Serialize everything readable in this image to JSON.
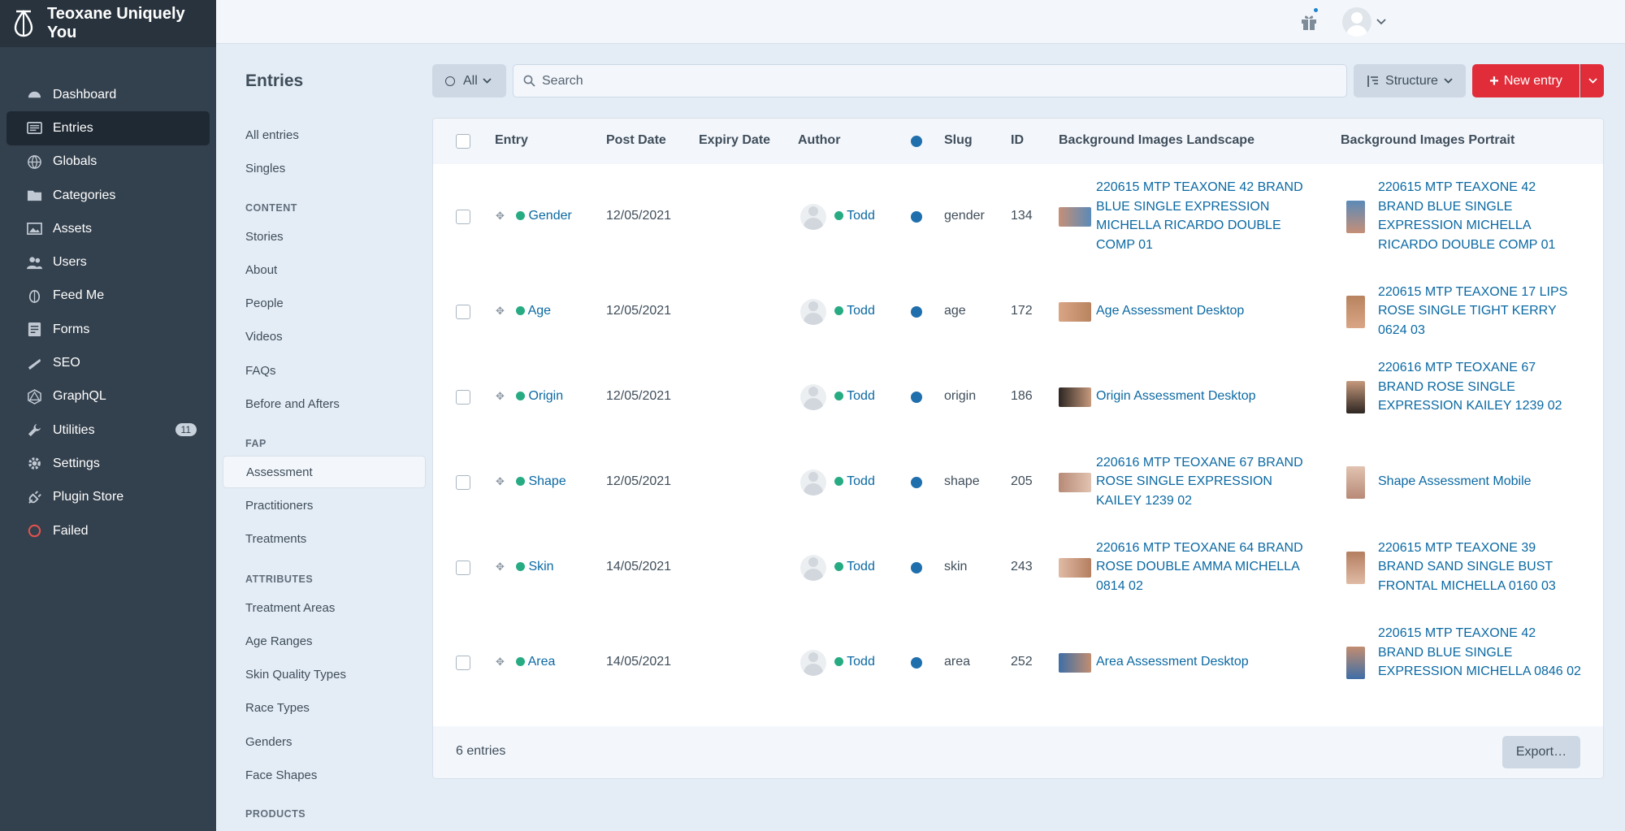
{
  "app": {
    "site_name": "Teoxane Uniquely You",
    "colors": {
      "sidebar_bg": "#33404d",
      "accent_red": "#e12d39",
      "link_blue": "#0b69a3",
      "status_green": "#27ab83"
    }
  },
  "global_nav": [
    {
      "label": "Dashboard",
      "icon": "dashboard-icon"
    },
    {
      "label": "Entries",
      "icon": "entries-icon",
      "active": true
    },
    {
      "label": "Globals",
      "icon": "globe-icon"
    },
    {
      "label": "Categories",
      "icon": "folder-icon"
    },
    {
      "label": "Assets",
      "icon": "image-icon"
    },
    {
      "label": "Users",
      "icon": "users-icon"
    },
    {
      "label": "Feed Me",
      "icon": "feed-me-icon"
    },
    {
      "label": "Forms",
      "icon": "forms-icon"
    },
    {
      "label": "SEO",
      "icon": "seo-icon"
    },
    {
      "label": "GraphQL",
      "icon": "graphql-icon"
    },
    {
      "label": "Utilities",
      "icon": "wrench-icon",
      "badge": "11"
    },
    {
      "label": "Settings",
      "icon": "gear-icon"
    },
    {
      "label": "Plugin Store",
      "icon": "plug-icon"
    },
    {
      "label": "Failed",
      "icon": "failed-circle-icon"
    }
  ],
  "page": {
    "title": "Entries"
  },
  "sources": {
    "top": [
      "All entries",
      "Singles"
    ],
    "content_heading": "CONTENT",
    "content": [
      "Stories",
      "About",
      "People",
      "Videos",
      "FAQs",
      "Before and Afters"
    ],
    "fap_heading": "FAP",
    "fap": [
      "Assessment",
      "Practitioners",
      "Treatments"
    ],
    "attributes_heading": "ATTRIBUTES",
    "attributes": [
      "Treatment Areas",
      "Age Ranges",
      "Skin Quality Types",
      "Race Types",
      "Genders",
      "Face Shapes"
    ],
    "products_heading": "PRODUCTS",
    "selected": "Assessment"
  },
  "toolbar": {
    "status_label": "All",
    "search_placeholder": "Search",
    "structure_label": "Structure",
    "new_entry_label": "New entry"
  },
  "table": {
    "columns": [
      "Entry",
      "Post Date",
      "Expiry Date",
      "Author",
      "Slug",
      "ID",
      "Background Images Landscape",
      "Background Images Portrait"
    ],
    "rows": [
      {
        "entry": "Gender",
        "post_date": "12/05/2021",
        "expiry": "",
        "author": "Todd",
        "slug": "gender",
        "id": "134",
        "landscape": "220615 MTP TEAXONE 42 BRAND BLUE SINGLE EXPRESSION MICHELLA RICARDO DOUBLE COMP 01",
        "portrait": "220615 MTP TEAXONE 42 BRAND BLUE SINGLE EXPRESSION MICHELLA RICARDO DOUBLE COMP 01"
      },
      {
        "entry": "Age",
        "post_date": "12/05/2021",
        "expiry": "",
        "author": "Todd",
        "slug": "age",
        "id": "172",
        "landscape": "Age Assessment Desktop",
        "portrait": "220615 MTP TEAXONE 17 LIPS ROSE SINGLE TIGHT KERRY 0624 03"
      },
      {
        "entry": "Origin",
        "post_date": "12/05/2021",
        "expiry": "",
        "author": "Todd",
        "slug": "origin",
        "id": "186",
        "landscape": "Origin Assessment Desktop",
        "portrait": "220616 MTP TEOXANE 67 BRAND ROSE SINGLE EXPRESSION KAILEY 1239 02"
      },
      {
        "entry": "Shape",
        "post_date": "12/05/2021",
        "expiry": "",
        "author": "Todd",
        "slug": "shape",
        "id": "205",
        "landscape": "220616 MTP TEOXANE 67 BRAND ROSE SINGLE EXPRESSION KAILEY 1239 02",
        "portrait": "Shape Assessment Mobile"
      },
      {
        "entry": "Skin",
        "post_date": "14/05/2021",
        "expiry": "",
        "author": "Todd",
        "slug": "skin",
        "id": "243",
        "landscape": "220616 MTP TEOXANE 64 BRAND ROSE DOUBLE AMMA MICHELLA 0814 02",
        "portrait": "220615 MTP TEAXONE 39 BRAND SAND SINGLE BUST FRONTAL MICHELLA 0160 03"
      },
      {
        "entry": "Area",
        "post_date": "14/05/2021",
        "expiry": "",
        "author": "Todd",
        "slug": "area",
        "id": "252",
        "landscape": "Area Assessment Desktop",
        "portrait": "220615 MTP TEAXONE 42 BRAND BLUE SINGLE EXPRESSION MICHELLA 0846 02"
      }
    ]
  },
  "footer": {
    "count": "6 entries",
    "export_label": "Export…"
  }
}
